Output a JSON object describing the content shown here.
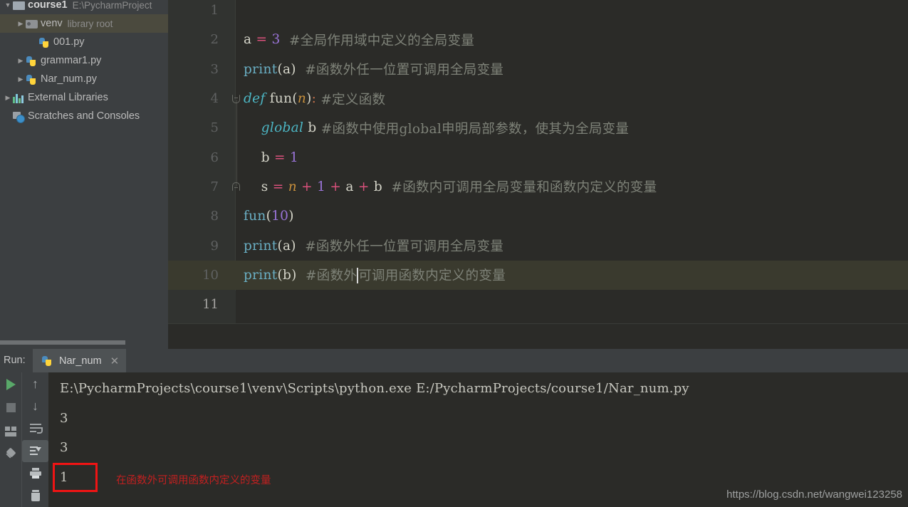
{
  "project_tree": {
    "items": [
      {
        "arrow": "▼",
        "icon": "module-icon",
        "label": "course1",
        "sub": "E:\\PycharmProject",
        "indent": 1,
        "bold": true,
        "selected": false,
        "clipped_top": true
      },
      {
        "arrow": "▶",
        "icon": "folder-icon",
        "label": "venv",
        "sub": "library root",
        "indent": 2,
        "bold": false,
        "selected": true
      },
      {
        "arrow": "",
        "icon": "python-file-icon",
        "label": "001.py",
        "sub": "",
        "indent": 3,
        "bold": false,
        "selected": false
      },
      {
        "arrow": "▶",
        "icon": "python-file-icon",
        "label": "grammar1.py",
        "sub": "",
        "indent": 2,
        "bold": false,
        "selected": false
      },
      {
        "arrow": "▶",
        "icon": "python-file-icon",
        "label": "Nar_num.py",
        "sub": "",
        "indent": 2,
        "bold": false,
        "selected": false
      },
      {
        "arrow": "▶",
        "icon": "external-libraries-icon",
        "label": "External Libraries",
        "sub": "",
        "indent": 1,
        "bold": false,
        "selected": false
      },
      {
        "arrow": "",
        "icon": "scratches-icon",
        "label": "Scratches and Consoles",
        "sub": "",
        "indent": 1,
        "bold": false,
        "selected": false
      }
    ]
  },
  "editor": {
    "active_line": 10,
    "caret_line": 11,
    "lines": [
      {
        "num": "1",
        "tokens": []
      },
      {
        "num": "2",
        "tokens": [
          {
            "t": "a",
            "c": "t-ident"
          },
          {
            "t": " ",
            "c": "t-ident"
          },
          {
            "t": "=",
            "c": "t-op"
          },
          {
            "t": " ",
            "c": "t-ident"
          },
          {
            "t": "3",
            "c": "t-num"
          },
          {
            "t": "  #全局作用域中定义的全局变量",
            "c": "t-comment"
          }
        ]
      },
      {
        "num": "3",
        "tokens": [
          {
            "t": "print",
            "c": "t-func"
          },
          {
            "t": "(a)",
            "c": "t-punct"
          },
          {
            "t": "  #函数外任一位置可调用全局变量",
            "c": "t-comment"
          }
        ]
      },
      {
        "num": "4",
        "fold": "open",
        "tokens": [
          {
            "t": "def",
            "c": "t-kw"
          },
          {
            "t": " ",
            "c": "t-ident"
          },
          {
            "t": "fun",
            "c": "t-ident"
          },
          {
            "t": "(",
            "c": "t-punct"
          },
          {
            "t": "n",
            "c": "t-param"
          },
          {
            "t": ")",
            "c": "t-punct"
          },
          {
            "t": ":",
            "c": "t-colon"
          },
          {
            "t": " #定义函数",
            "c": "t-comment"
          }
        ]
      },
      {
        "num": "5",
        "tokens": [
          {
            "t": "    ",
            "c": "t-ident"
          },
          {
            "t": "global",
            "c": "t-kw"
          },
          {
            "t": " b",
            "c": "t-ident"
          },
          {
            "t": " #函数中使用global申明局部参数，使其为全局变量",
            "c": "t-comment"
          }
        ]
      },
      {
        "num": "6",
        "tokens": [
          {
            "t": "    b ",
            "c": "t-ident"
          },
          {
            "t": "=",
            "c": "t-op"
          },
          {
            "t": " ",
            "c": "t-ident"
          },
          {
            "t": "1",
            "c": "t-num"
          }
        ]
      },
      {
        "num": "7",
        "fold": "end",
        "tokens": [
          {
            "t": "    s ",
            "c": "t-ident"
          },
          {
            "t": "=",
            "c": "t-op"
          },
          {
            "t": " ",
            "c": "t-ident"
          },
          {
            "t": "n",
            "c": "t-param"
          },
          {
            "t": " ",
            "c": "t-ident"
          },
          {
            "t": "+",
            "c": "t-op"
          },
          {
            "t": " ",
            "c": "t-ident"
          },
          {
            "t": "1",
            "c": "t-num"
          },
          {
            "t": " ",
            "c": "t-ident"
          },
          {
            "t": "+",
            "c": "t-op"
          },
          {
            "t": " a ",
            "c": "t-ident"
          },
          {
            "t": "+",
            "c": "t-op"
          },
          {
            "t": " b",
            "c": "t-ident"
          },
          {
            "t": "  #函数内可调用全局变量和函数内定义的变量",
            "c": "t-comment"
          }
        ]
      },
      {
        "num": "8",
        "tokens": [
          {
            "t": "fun",
            "c": "t-func"
          },
          {
            "t": "(",
            "c": "t-punct"
          },
          {
            "t": "10",
            "c": "t-num"
          },
          {
            "t": ")",
            "c": "t-punct"
          }
        ]
      },
      {
        "num": "9",
        "tokens": [
          {
            "t": "print",
            "c": "t-func"
          },
          {
            "t": "(a)",
            "c": "t-punct"
          },
          {
            "t": "  #函数外任一位置可调用全局变量",
            "c": "t-comment"
          }
        ]
      },
      {
        "num": "10",
        "tokens": [
          {
            "t": "print",
            "c": "t-func"
          },
          {
            "t": "(b)",
            "c": "t-punct"
          },
          {
            "t": "  #函数外",
            "c": "t-comment"
          },
          {
            "t": "CARET",
            "c": "caret"
          },
          {
            "t": "可调用函数内定义的变量",
            "c": "t-comment"
          }
        ]
      },
      {
        "num": "11",
        "tokens": []
      }
    ]
  },
  "run_panel": {
    "run_label": "Run:",
    "tab_name": "Nar_num",
    "tab_close": "✕",
    "toolbar_left": [
      {
        "name": "rerun-button",
        "icon": "run-icon"
      },
      {
        "name": "stop-button",
        "icon": "stop-icon"
      },
      {
        "name": "layout-button",
        "icon": "layout-icon"
      },
      {
        "name": "pin-tab-button",
        "icon": "pin-icon"
      }
    ],
    "toolbar_right": [
      {
        "name": "up-button",
        "icon": "arrow-up-icon",
        "glyph": "↑"
      },
      {
        "name": "down-button",
        "icon": "arrow-down-icon",
        "glyph": "↓"
      },
      {
        "name": "soft-wrap-button",
        "icon": "soft-wrap-icon",
        "glyph": ""
      },
      {
        "name": "scroll-to-end-button",
        "icon": "scroll-to-end-icon",
        "glyph": "",
        "active": true
      },
      {
        "name": "print-button",
        "icon": "print-icon",
        "glyph": ""
      },
      {
        "name": "clear-all-button",
        "icon": "trash-icon",
        "glyph": ""
      }
    ],
    "console_lines": [
      "E:\\PycharmProjects\\course1\\venv\\Scripts\\python.exe E:/PycharmProjects/course1/Nar_num.py",
      "3",
      "3",
      "1"
    ],
    "annotation": "在函数外可调用函数内定义的变量",
    "watermark": "https://blog.csdn.net/wangwei123258"
  }
}
